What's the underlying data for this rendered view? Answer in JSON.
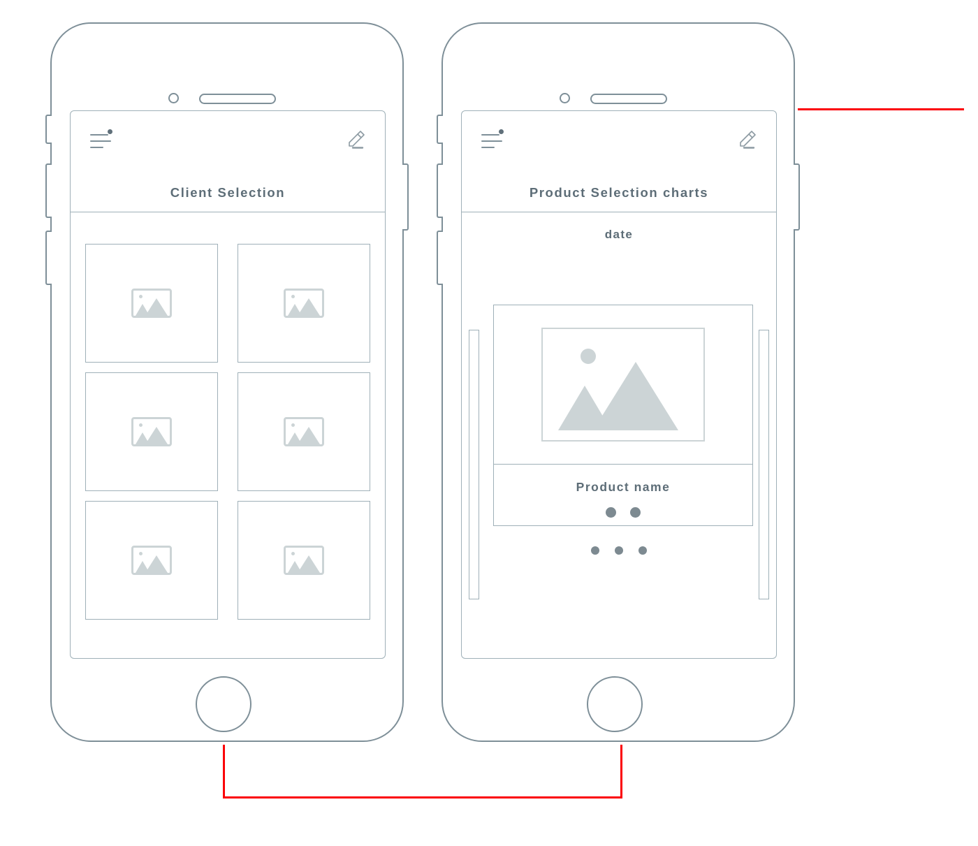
{
  "screens": [
    {
      "id": "client-selection",
      "appbar": {
        "menu_icon": "hamburger-menu-icon",
        "edit_icon": "pencil-edit-icon",
        "title": "Client Selection"
      },
      "body_type": "grid",
      "grid": {
        "columns": 2,
        "rows": 3,
        "cells": [
          {
            "icon": "image-placeholder-icon"
          },
          {
            "icon": "image-placeholder-icon"
          },
          {
            "icon": "image-placeholder-icon"
          },
          {
            "icon": "image-placeholder-icon"
          },
          {
            "icon": "image-placeholder-icon"
          },
          {
            "icon": "image-placeholder-icon"
          }
        ]
      }
    },
    {
      "id": "product-selection-charts",
      "appbar": {
        "menu_icon": "hamburger-menu-icon",
        "edit_icon": "pencil-edit-icon",
        "title": "Product Selection charts"
      },
      "body_type": "carousel",
      "date_label": "date",
      "rails": {
        "left": "carousel-prev-rail",
        "right": "carousel-next-rail"
      },
      "card": {
        "media_icon": "image-placeholder-icon",
        "product_name": "Product name",
        "card_dots_count": 2
      },
      "page_dots_count": 3
    }
  ],
  "hardware": {
    "camera": "front-camera",
    "speaker": "earpiece-speaker",
    "home_button": "home-button",
    "mute_switch": "mute-switch-button",
    "volume_down": "volume-down-button",
    "volume_up": "volume-up-button",
    "power": "power-button"
  },
  "connectors": [
    {
      "id": "flow-top-right",
      "color": "#fb0007"
    },
    {
      "id": "flow-screen1-to-screen2",
      "color": "#fb0007"
    }
  ],
  "colors": {
    "outline": "#7e8f98",
    "screen_outline": "#9fb0b8",
    "text": "#5d6d77",
    "placeholder_fill": "#ccd4d6",
    "dot": "#7d8a91",
    "connector": "#fb0007",
    "background": "#ffffff"
  }
}
